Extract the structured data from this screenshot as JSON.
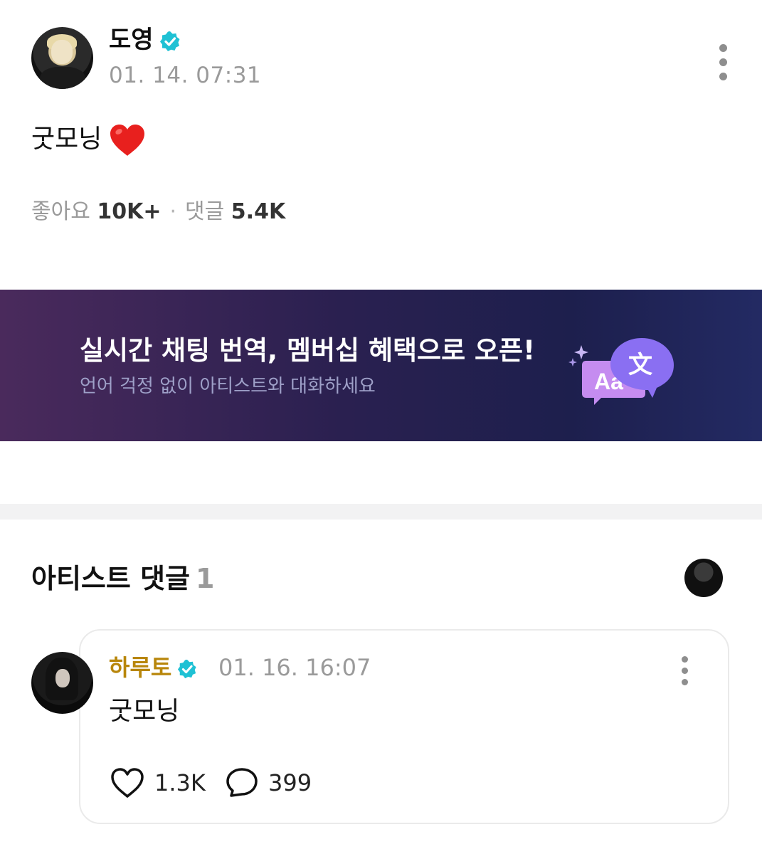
{
  "post": {
    "author": "도영",
    "timestamp": "01. 14. 07:31",
    "body": "굿모닝",
    "likes_label": "좋아요",
    "likes_count": "10K+",
    "comments_label": "댓글",
    "comments_count": "5.4K"
  },
  "banner": {
    "title": "실시간 채팅 번역, 멤버십 혜택으로 오픈!",
    "subtitle": "언어 걱정 없이 아티스트와 대화하세요",
    "icon_glyph_back": "Aa",
    "icon_glyph_front": "文"
  },
  "artist_comments": {
    "title": "아티스트 댓글",
    "count": "1",
    "items": [
      {
        "author": "하루토",
        "timestamp": "01. 16. 16:07",
        "text": "굿모닝",
        "likes": "1.3K",
        "replies": "399"
      }
    ]
  },
  "colors": {
    "verified": "#1fc1d4",
    "artist_name": "#b8860b",
    "banner_start": "#4a2a5c",
    "banner_end": "#232a63"
  }
}
